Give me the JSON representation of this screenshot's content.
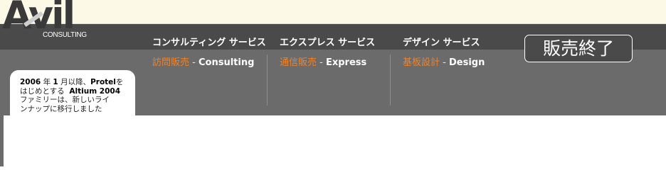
{
  "logo": {
    "main": "Avil",
    "sub": "CONSULTING"
  },
  "nav": [
    {
      "title": "コンサルティング サービス",
      "sub_jp": "訪問販売",
      "sep": " - ",
      "sub_en": "Consulting"
    },
    {
      "title": "エクスプレス サービス",
      "sub_jp": "通信販売",
      "sep": " - ",
      "sub_en": "Express"
    },
    {
      "title": "デザイン サービス",
      "sub_jp": "基板設計",
      "sep": " - ",
      "sub_en": "Design"
    }
  ],
  "end_button": "販売終了",
  "notice": {
    "line1_a": "2006",
    "line1_b": " 年 ",
    "line1_c": "1",
    "line1_d": " 月以降、",
    "line1_e": "Protel",
    "line1_f": "を",
    "line2_a": "はじめとする  ",
    "line2_b": "Altium 2004",
    "line3": "ファミリーは、新しいライ",
    "line4": "ンナップに移行しました"
  },
  "colors": {
    "accent": "#f5821f",
    "dark_band": "#4a4a4a",
    "mid_band": "#6b6b6b",
    "top_band": "#fcfae6"
  }
}
